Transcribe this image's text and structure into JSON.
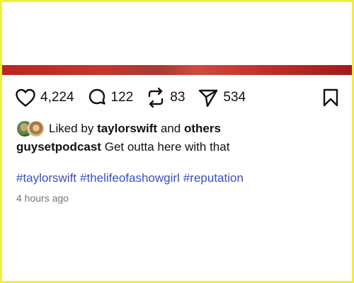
{
  "actions": {
    "likes": "4,224",
    "comments": "122",
    "reposts": "83",
    "shares": "534"
  },
  "liked_by": {
    "prefix": "Liked by",
    "user": "taylorswift",
    "connector": "and",
    "others": "others"
  },
  "caption": {
    "username": "guysetpodcast",
    "text": "Get outta here with that"
  },
  "hashtags": [
    "#taylorswift",
    "#thelifeofashowgirl",
    "#reputation"
  ],
  "timestamp": "4 hours ago",
  "colors": {
    "border": "#f0ef3a",
    "hashtag": "#3a4fc0",
    "timestamp": "#757575",
    "media": "#b8261c"
  },
  "icons": [
    "heart-icon",
    "comment-icon",
    "repost-icon",
    "share-icon",
    "bookmark-icon"
  ]
}
